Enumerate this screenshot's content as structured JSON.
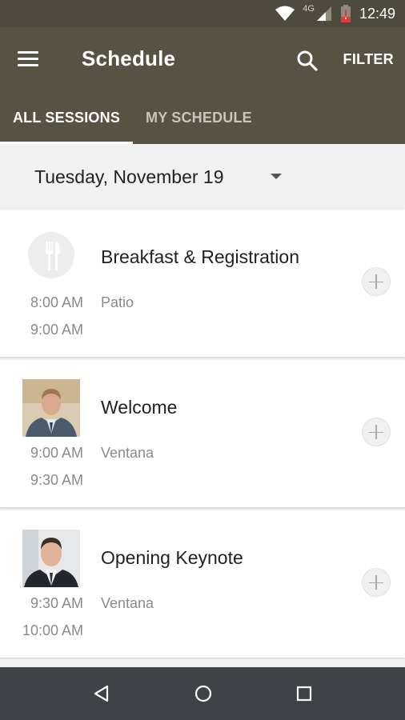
{
  "status_bar": {
    "network_label": "4G",
    "time": "12:49",
    "icons": [
      "wifi-icon",
      "cell-signal-icon",
      "battery-low-icon"
    ]
  },
  "app_bar": {
    "title": "Schedule",
    "menu_icon": "hamburger-menu-icon",
    "search_icon": "search-icon",
    "filter_label": "FILTER"
  },
  "tabs": [
    {
      "label": "ALL SESSIONS",
      "selected": true
    },
    {
      "label": "MY SCHEDULE",
      "selected": false
    }
  ],
  "date_selector": {
    "selected": "Tuesday, November 19",
    "icon": "dropdown-arrow-icon"
  },
  "sessions": [
    {
      "title": "Breakfast & Registration",
      "start": "8:00 AM",
      "end": "9:00 AM",
      "room": "Patio",
      "image": "food-icon"
    },
    {
      "title": "Welcome",
      "start": "9:00 AM",
      "end": "9:30 AM",
      "room": "Ventana",
      "image": "speaker-photo"
    },
    {
      "title": "Opening Keynote",
      "start": "9:30 AM",
      "end": "10:00 AM",
      "room": "Ventana",
      "image": "speaker-photo"
    }
  ],
  "nav_bar": {
    "back_icon": "back-triangle-icon",
    "home_icon": "home-circle-icon",
    "recents_icon": "recents-square-icon"
  },
  "colors": {
    "app_bar": "#575242",
    "status_bar": "#4f4a3e",
    "nav_bar": "#3f4246",
    "background": "#f1f1f1"
  }
}
